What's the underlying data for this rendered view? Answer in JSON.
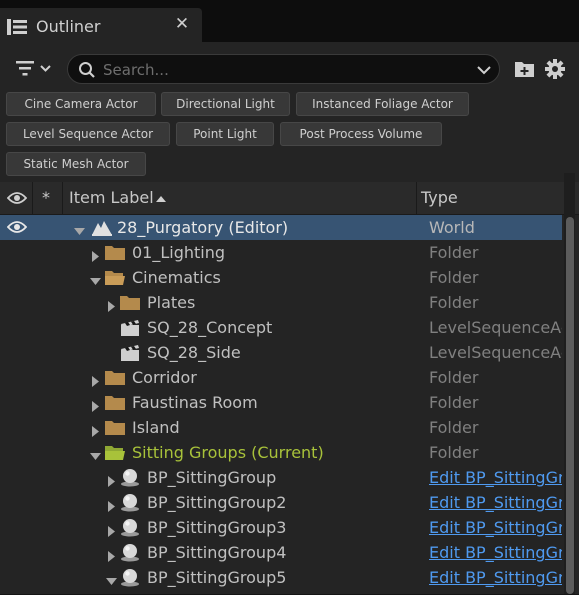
{
  "tab": {
    "title": "Outliner",
    "icon": "outliner-list-icon",
    "close_icon": "close-icon"
  },
  "toolbar": {
    "search_placeholder": "Search...",
    "filter_icon": "filter-icon",
    "add_folder_icon": "add-folder-icon",
    "settings_icon": "gear-icon"
  },
  "filter_chips": [
    "Cine Camera Actor",
    "Directional Light",
    "Instanced Foliage Actor",
    "Level Sequence Actor",
    "Point Light",
    "Post Process Volume",
    "Static Mesh Actor"
  ],
  "columns": {
    "visibility_icon": "eye-icon",
    "pin": "*",
    "item_label": "Item Label",
    "sort": "ascending",
    "type": "Type"
  },
  "rows": [
    {
      "label": "28_Purgatory (Editor)",
      "type": "World",
      "icon": "world-icon",
      "expanded": true,
      "selected": true
    },
    {
      "label": "01_Lighting",
      "type": "Folder",
      "icon": "folder-icon",
      "expanded": false
    },
    {
      "label": "Cinematics",
      "type": "Folder",
      "icon": "folder-open-icon",
      "expanded": true
    },
    {
      "label": "Plates",
      "type": "Folder",
      "icon": "folder-icon",
      "expanded": false
    },
    {
      "label": "SQ_28_Concept",
      "type": "LevelSequenceActor",
      "icon": "clapperboard-icon"
    },
    {
      "label": "SQ_28_Side",
      "type": "LevelSequenceActor",
      "icon": "clapperboard-icon"
    },
    {
      "label": "Corridor",
      "type": "Folder",
      "icon": "folder-icon",
      "expanded": false
    },
    {
      "label": "Faustinas Room",
      "type": "Folder",
      "icon": "folder-icon",
      "expanded": false
    },
    {
      "label": "Island",
      "type": "Folder",
      "icon": "folder-icon",
      "expanded": false
    },
    {
      "label": "Sitting Groups (Current)",
      "type": "Folder",
      "icon": "folder-open-icon",
      "expanded": true,
      "current": true
    },
    {
      "label": "BP_SittingGroup",
      "type": "Edit BP_SittingGroup",
      "icon": "actor-sphere-icon",
      "expanded": false
    },
    {
      "label": "BP_SittingGroup2",
      "type": "Edit BP_SittingGroup",
      "icon": "actor-sphere-icon",
      "expanded": false
    },
    {
      "label": "BP_SittingGroup3",
      "type": "Edit BP_SittingGroup",
      "icon": "actor-sphere-icon",
      "expanded": false
    },
    {
      "label": "BP_SittingGroup4",
      "type": "Edit BP_SittingGroup",
      "icon": "actor-sphere-icon",
      "expanded": false
    },
    {
      "label": "BP_SittingGroup5",
      "type": "Edit BP_SittingGroup",
      "icon": "actor-sphere-icon",
      "expanded": true
    }
  ],
  "colors": {
    "selection": "#375473",
    "current_folder": "#a8c23a",
    "link": "#4f9af0",
    "folder": "#b48a4c"
  }
}
